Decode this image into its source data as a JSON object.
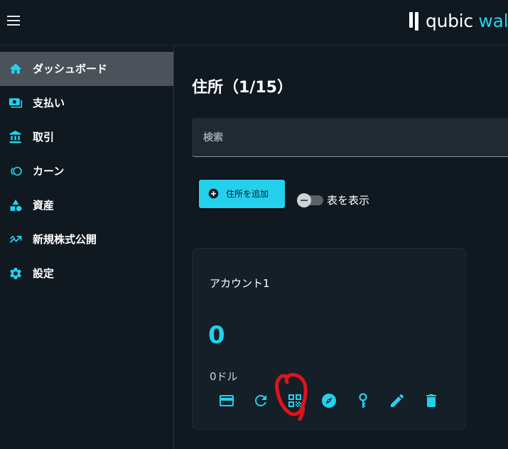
{
  "brand": {
    "name_main": "qubic",
    "name_accent": " walle"
  },
  "sidebar": {
    "items": [
      {
        "label": "ダッシュボード",
        "icon": "home-icon",
        "active": true
      },
      {
        "label": "支払い",
        "icon": "payments-icon"
      },
      {
        "label": "取引",
        "icon": "bank-icon"
      },
      {
        "label": "カーン",
        "icon": "coins-icon"
      },
      {
        "label": "資産",
        "icon": "assets-icon"
      },
      {
        "label": "新規株式公開",
        "icon": "ipo-icon"
      },
      {
        "label": "設定",
        "icon": "gear-icon"
      }
    ]
  },
  "main": {
    "title": "住所（1/15）",
    "search_placeholder": "検索",
    "add_button": "住所を追加",
    "toggle_label": "表を表示",
    "toggle_on": false
  },
  "card": {
    "account_name": "アカウント1",
    "balance": "0",
    "usd": "0ドル",
    "actions": [
      "card-icon",
      "refresh-icon",
      "qr-code-icon",
      "compass-icon",
      "key-icon",
      "edit-icon",
      "delete-icon"
    ]
  },
  "colors": {
    "accent": "#23d1ed",
    "background": "#101820",
    "active_nav": "#4b525a",
    "annotation": "#e0131c"
  }
}
